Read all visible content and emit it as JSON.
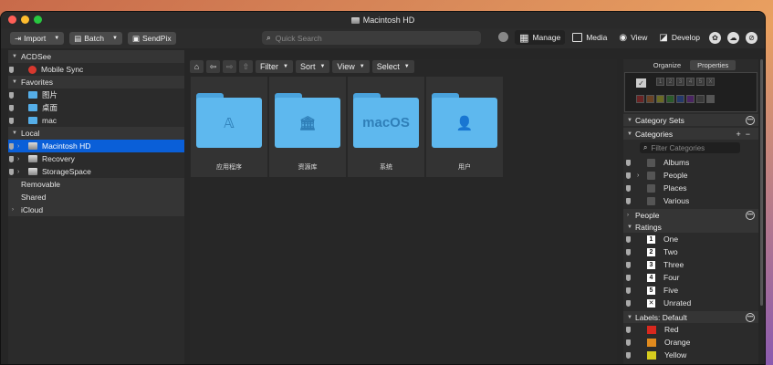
{
  "window": {
    "title": "Macintosh HD"
  },
  "toolbar": {
    "import_label": "Import",
    "batch_label": "Batch",
    "sendpix_label": "SendPix",
    "search_placeholder": "Quick Search",
    "modes": [
      {
        "label": "Manage",
        "active": true
      },
      {
        "label": "Media",
        "active": false
      },
      {
        "label": "View",
        "active": false
      },
      {
        "label": "Develop",
        "active": false
      }
    ]
  },
  "sidebar": {
    "sections": {
      "acdsee": "ACDSee",
      "favorites": "Favorites",
      "local": "Local",
      "removable": "Removable",
      "shared": "Shared",
      "icloud": "iCloud"
    },
    "items": {
      "mobile_sync": "Mobile Sync",
      "pictures": "图片",
      "desktop": "桌面",
      "mac": "mac",
      "macintosh_hd": "Macintosh HD",
      "recovery": "Recovery",
      "storagespace": "StorageSpace"
    }
  },
  "browser": {
    "filter_label": "Filter",
    "sort_label": "Sort",
    "view_label": "View",
    "select_label": "Select",
    "folders": [
      {
        "label": "应用程序",
        "glyph": "𝔸"
      },
      {
        "label": "资源库",
        "glyph": "🏛"
      },
      {
        "label": "系统",
        "glyph": "macOS"
      },
      {
        "label": "用户",
        "glyph": "👤"
      }
    ]
  },
  "properties": {
    "tab_organize": "Organize",
    "tab_properties": "Properties",
    "ratings_quick": [
      "1",
      "2",
      "3",
      "4",
      "5",
      "X"
    ],
    "label_colors": [
      "#9a2b2b",
      "#9a5a2b",
      "#9a9a2b",
      "#3a7a3a",
      "#2b4f9a",
      "#6a2b8a",
      "#5a5a5a"
    ],
    "category_sets": "Category Sets",
    "categories": "Categories",
    "filter_placeholder": "Filter Categories",
    "category_items": [
      "Albums",
      "People",
      "Places",
      "Various"
    ],
    "people": "People",
    "ratings": "Ratings",
    "rating_items": [
      {
        "num": "1",
        "label": "One"
      },
      {
        "num": "2",
        "label": "Two"
      },
      {
        "num": "3",
        "label": "Three"
      },
      {
        "num": "4",
        "label": "Four"
      },
      {
        "num": "5",
        "label": "Five"
      },
      {
        "num": "✕",
        "label": "Unrated"
      }
    ],
    "labels_header": "Labels: Default",
    "label_items": [
      {
        "label": "Red",
        "color": "#d8281e"
      },
      {
        "label": "Orange",
        "color": "#e08a1e"
      },
      {
        "label": "Yellow",
        "color": "#d6cc1e"
      }
    ]
  }
}
